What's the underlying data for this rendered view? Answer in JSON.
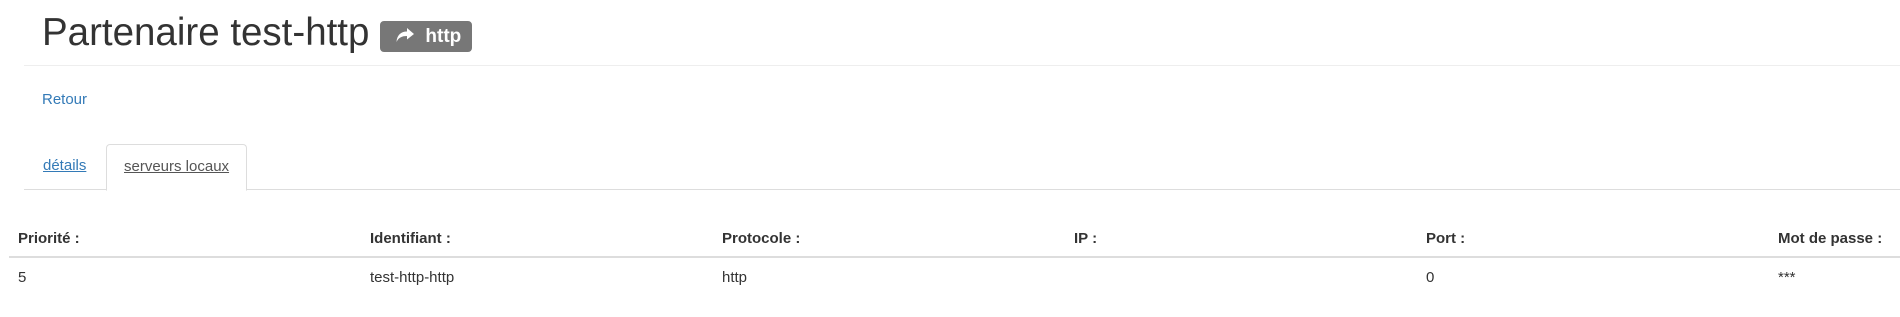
{
  "header": {
    "title": "Partenaire test-http",
    "badge": {
      "icon": "share-arrow-icon",
      "label": "http",
      "color": "#777777"
    }
  },
  "back_link": "Retour",
  "tabs": [
    {
      "label": "détails",
      "active": false
    },
    {
      "label": "serveurs locaux",
      "active": true
    }
  ],
  "table": {
    "columns": [
      "Priorité :",
      "Identifiant :",
      "Protocole :",
      "IP :",
      "Port :",
      "Mot de passe :"
    ],
    "rows": [
      [
        "5",
        "test-http-http",
        "http",
        "",
        "0",
        "***"
      ]
    ]
  },
  "colors": {
    "link": "#337ab7",
    "text": "#333333",
    "badge": "#777777"
  }
}
